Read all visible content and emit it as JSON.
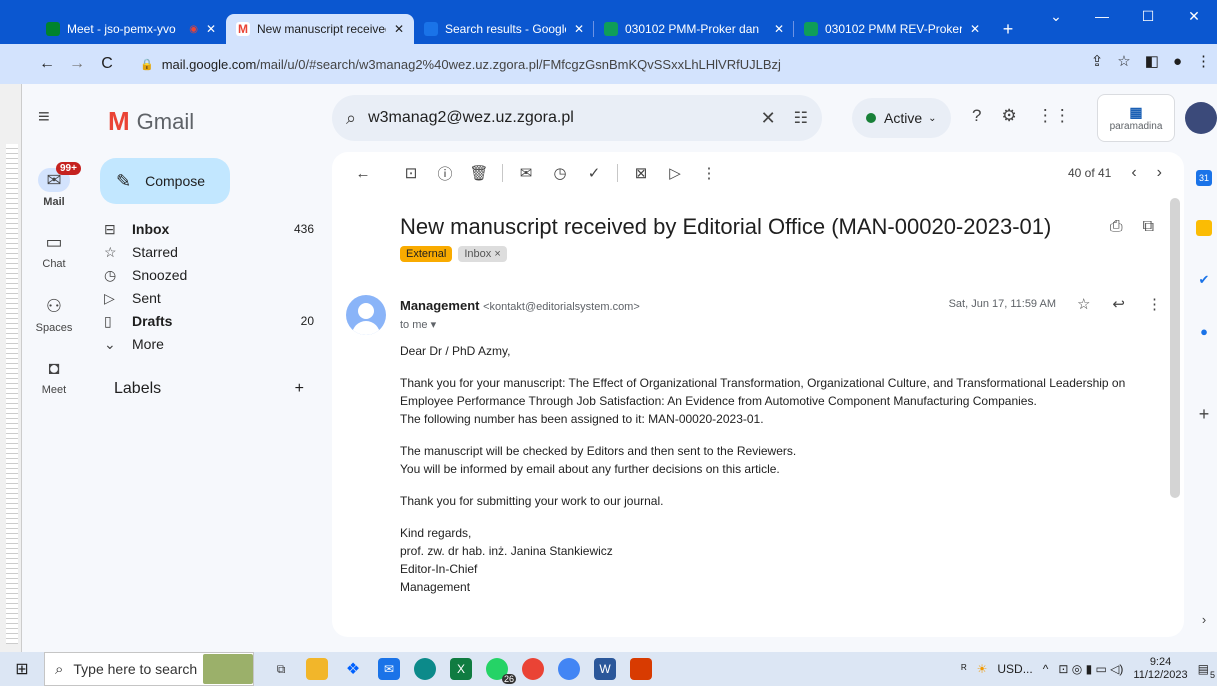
{
  "browser": {
    "tabs": [
      {
        "title": "Meet - jso-pemx-yvo",
        "icon": "meet-icon",
        "color": "#00832d"
      },
      {
        "title": "New manuscript received",
        "icon": "gmail-icon",
        "color": "#ea4335",
        "active": true
      },
      {
        "title": "Search results - Google D",
        "icon": "drive-icon",
        "color": "#1a73e8"
      },
      {
        "title": "030102 PMM-Proker dan",
        "icon": "sheets-icon",
        "color": "#0f9d58"
      },
      {
        "title": "030102 PMM REV-Proker",
        "icon": "sheets-icon",
        "color": "#0f9d58"
      }
    ],
    "url_host": "mail.google.com",
    "url_path": "/mail/u/0/#search/w3manag2%40wez.uz.zgora.pl/FMfcgzGsnBmKQvSSxxLhLHlVRfUJLBzj"
  },
  "header": {
    "app_name": "Gmail",
    "search_value": "w3manag2@wez.uz.zgora.pl",
    "status": "Active",
    "org_name": "paramadina"
  },
  "rail": {
    "mail_label": "Mail",
    "mail_badge": "99+",
    "chat_label": "Chat",
    "spaces_label": "Spaces",
    "meet_label": "Meet"
  },
  "sidebar": {
    "compose": "Compose",
    "folders": [
      {
        "label": "Inbox",
        "count": "436",
        "bold": true,
        "icon": "inbox-icon"
      },
      {
        "label": "Starred",
        "count": "",
        "bold": false,
        "icon": "star-icon"
      },
      {
        "label": "Snoozed",
        "count": "",
        "bold": false,
        "icon": "clock-icon"
      },
      {
        "label": "Sent",
        "count": "",
        "bold": false,
        "icon": "send-icon"
      },
      {
        "label": "Drafts",
        "count": "20",
        "bold": true,
        "icon": "draft-icon"
      },
      {
        "label": "More",
        "count": "",
        "bold": false,
        "icon": "chevron-down-icon"
      }
    ],
    "labels_heading": "Labels"
  },
  "message": {
    "pager": "40 of 41",
    "subject": "New manuscript received by Editorial Office (MAN-00020-2023-01)",
    "tag_external": "External",
    "tag_inbox": "Inbox ×",
    "sender_name": "Management",
    "sender_email": "<kontakt@editorialsystem.com>",
    "to": "to me ▾",
    "date": "Sat, Jun 17, 11:59 AM",
    "greeting": "Dear Dr / PhD Azmy,",
    "para1": "Thank you for your manuscript: The Effect of Organizational Transformation, Organizational Culture, and Transformational Leadership on Employee Performance Through Job Satisfaction: An Evidence from Automotive Component Manufacturing Companies.",
    "para1b": "The following number has been assigned to it: MAN-00020-2023-01.",
    "para2": "The manuscript will be checked by Editors and then sent to the Reviewers.",
    "para2b": "You will be informed by email about any further decisions on this article.",
    "para3": "Thank you for submitting your work to our journal.",
    "closing": "Kind regards,",
    "sig1": "prof. zw. dr hab. inż. Janina Stankiewicz",
    "sig2": "Editor-In-Chief",
    "sig3": "Management"
  },
  "taskbar": {
    "search_placeholder": "Type here to search",
    "weather": "USD...",
    "time": "9:24",
    "date": "11/12/2023",
    "notif_count": "5",
    "whatsapp_badge": "26"
  }
}
